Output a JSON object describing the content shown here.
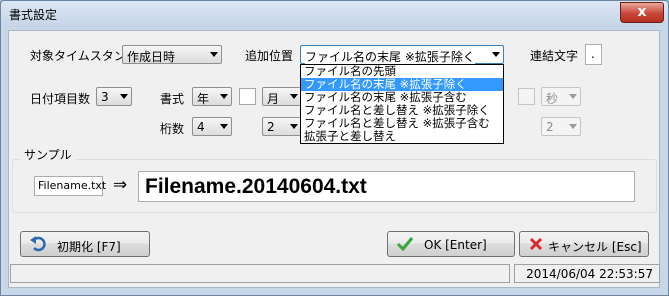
{
  "window": {
    "title": "書式設定",
    "close_glyph": "x"
  },
  "timestamp": {
    "label": "対象タイムスタンプ",
    "value": "作成日時"
  },
  "position": {
    "label": "追加位置",
    "value": "ファイル名の末尾 ※拡張子除く",
    "options": [
      "ファイル名の先頭",
      "ファイル名の末尾 ※拡張子除く",
      "ファイル名の末尾 ※拡張子含む",
      "ファイル名と差し替え ※拡張子除く",
      "ファイル名と差し替え ※拡張子含む",
      "拡張子と差し替え"
    ],
    "selected_index": 1
  },
  "joiner": {
    "label": "連結文字",
    "value": "."
  },
  "date_items": {
    "label": "日付項目数",
    "value": "3"
  },
  "format": {
    "label": "書式",
    "year": "年",
    "month": "月",
    "second": "秒"
  },
  "digits": {
    "label": "桁数",
    "year_digits": "4",
    "month_digits": "2",
    "second_digits": "2"
  },
  "sample": {
    "group_label": "サンプル",
    "source_name": "Filename.txt",
    "arrow": "⇒",
    "result_name": "Filename.20140604.txt"
  },
  "buttons": {
    "reset_label": "初期化 [F7]",
    "ok_label": "OK [Enter]",
    "cancel_label": "キャンセル [Esc]"
  },
  "status": {
    "datetime": "2014/06/04 22:53:57"
  },
  "colors": {
    "accent": "#3399ff",
    "close": "#c9473a",
    "ok_check": "#3aa53a",
    "cancel_x": "#d62b2b",
    "reset_arrow": "#2f68b4"
  }
}
